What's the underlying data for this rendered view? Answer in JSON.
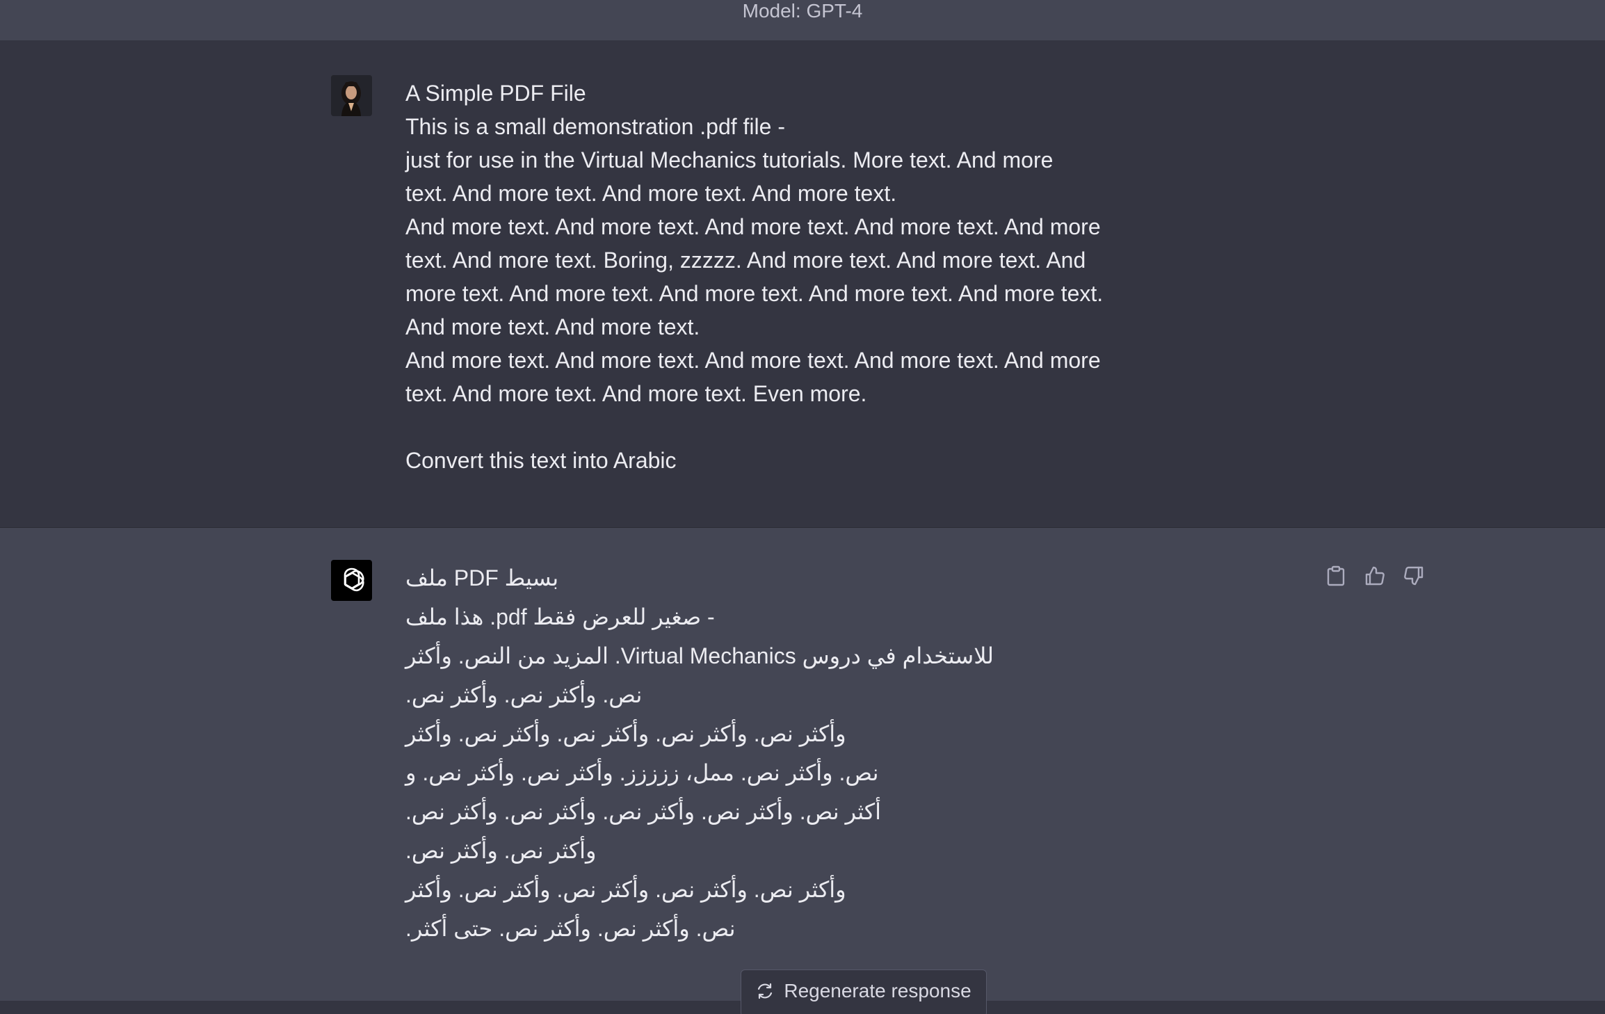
{
  "header": {
    "model_label": "Model: GPT-4"
  },
  "user_message": {
    "lines": [
      "A Simple PDF File",
      "This is a small demonstration .pdf file -",
      "just for use in the Virtual Mechanics tutorials. More text. And more",
      "text. And more text. And more text. And more text.",
      "And more text. And more text. And more text. And more text. And more",
      "text. And more text. Boring, zzzzz. And more text. And more text. And",
      "more text. And more text. And more text. And more text. And more text.",
      "And more text. And more text.",
      "And more text. And more text. And more text. And more text. And more",
      "text. And more text. And more text. Even more."
    ],
    "prompt": "Convert this text into Arabic"
  },
  "assistant_message": {
    "lines": [
      "بسيط PDF ملف",
      "- صغير للعرض فقط pdf. هذا ملف",
      "للاستخدام في دروس Virtual Mechanics. المزيد من النص. وأكثر",
      "نص. وأكثر نص. وأكثر نص.",
      "وأكثر نص. وأكثر نص. وأكثر نص. وأكثر نص. وأكثر",
      "نص. وأكثر نص. ممل، ززززز. وأكثر نص. وأكثر نص. و",
      "أكثر نص. وأكثر نص. وأكثر نص. وأكثر نص. وأكثر نص.",
      "وأكثر نص. وأكثر نص.",
      "وأكثر نص. وأكثر نص. وأكثر نص. وأكثر نص. وأكثر",
      "نص. وأكثر نص. وأكثر نص. حتى أكثر."
    ]
  },
  "actions": {
    "copy_icon": "clipboard-icon",
    "like_icon": "thumbs-up-icon",
    "dislike_icon": "thumbs-down-icon"
  },
  "footer": {
    "regenerate_label": "Regenerate response",
    "regenerate_icon": "refresh-icon"
  },
  "colors": {
    "background": "#343541",
    "assistant_background": "#444654",
    "text": "#ececf1"
  }
}
